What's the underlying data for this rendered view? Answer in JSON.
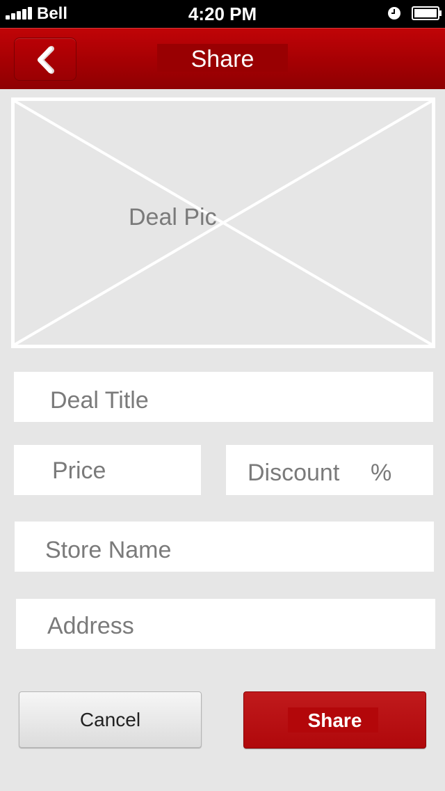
{
  "status_bar": {
    "carrier": "Bell",
    "time": "4:20 PM",
    "icons": [
      "signal-icon",
      "alarm-icon",
      "battery-icon"
    ]
  },
  "nav": {
    "title": "Share",
    "back_icon": "chevron-left-icon"
  },
  "deal_pic": {
    "label": "Deal Pic"
  },
  "form": {
    "deal_title": "Deal Title",
    "price": "Price",
    "discount": "Discount",
    "percent": "%",
    "store_name": "Store Name",
    "address": "Address"
  },
  "actions": {
    "cancel": "Cancel",
    "share": "Share"
  },
  "colors": {
    "brand_red": "#a50003",
    "background": "#e6e6e6",
    "field_bg": "#ffffff",
    "placeholder_text": "#7a7a7a"
  }
}
